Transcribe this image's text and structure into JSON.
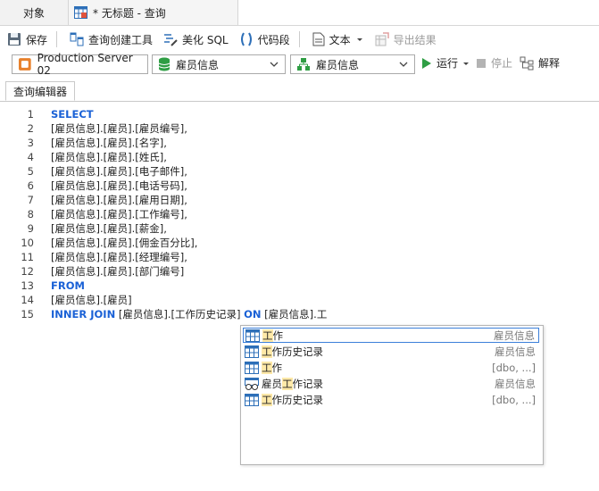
{
  "tabs": {
    "objects": "对象",
    "query": "* 无标题 - 查询"
  },
  "toolbar": {
    "save": "保存",
    "builder": "查询创建工具",
    "beautify": "美化 SQL",
    "snippet": "代码段",
    "text": "文本",
    "export": "导出结果"
  },
  "selectors": {
    "connection": "Production Server 02",
    "database": "雇员信息",
    "schema": "雇员信息",
    "run": "运行",
    "stop": "停止",
    "explain": "解释"
  },
  "editor_tab": "查询编辑器",
  "code": {
    "n1": "1",
    "l1": "SELECT",
    "n2": "2",
    "l2": "[雇员信息].[雇员].[雇员编号],",
    "n3": "3",
    "l3": "[雇员信息].[雇员].[名字],",
    "n4": "4",
    "l4": "[雇员信息].[雇员].[姓氏],",
    "n5": "5",
    "l5": "[雇员信息].[雇员].[电子邮件],",
    "n6": "6",
    "l6": "[雇员信息].[雇员].[电话号码],",
    "n7": "7",
    "l7": "[雇员信息].[雇员].[雇用日期],",
    "n8": "8",
    "l8": "[雇员信息].[雇员].[工作编号],",
    "n9": "9",
    "l9": "[雇员信息].[雇员].[薪金],",
    "n10": "10",
    "l10": "[雇员信息].[雇员].[佣金百分比],",
    "n11": "11",
    "l11": "[雇员信息].[雇员].[经理编号],",
    "n12": "12",
    "l12": "[雇员信息].[雇员].[部门编号]",
    "n13": "13",
    "l13": "FROM",
    "n14": "14",
    "l14": "[雇员信息].[雇员]",
    "n15": "15",
    "l15_kw1": "INNER JOIN",
    "l15_a": " [雇员信息].[工作历史记录] ",
    "l15_kw2": "ON",
    "l15_b": " [雇员信息].工"
  },
  "autocomplete": {
    "i1_hl": "工",
    "i1_rest": "作",
    "i1_schema": "雇员信息",
    "i2_hl": "工",
    "i2_rest": "作历史记录",
    "i2_schema": "雇员信息",
    "i3_hl": "工",
    "i3_rest": "作",
    "i3_schema": "[dbo, ...]",
    "i4_pre": "雇员",
    "i4_hl": "工",
    "i4_rest": "作记录",
    "i4_schema": "雇员信息",
    "i5_hl": "工",
    "i5_rest": "作历史记录",
    "i5_schema": "[dbo, ...]"
  },
  "colors": {
    "keyword": "#1a61d6",
    "highlight": "#ffe9a8",
    "selection": "#3b7fd9"
  }
}
